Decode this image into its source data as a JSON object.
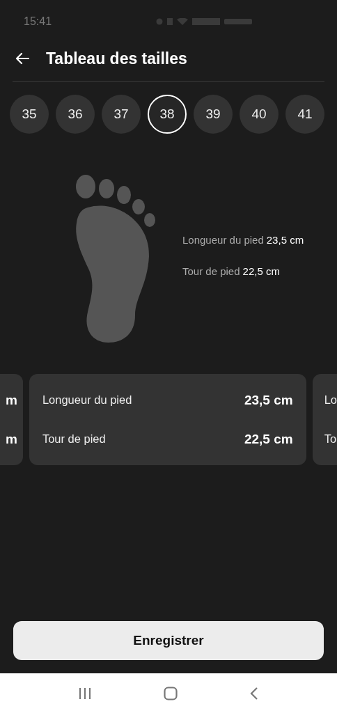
{
  "status_bar": {
    "time": "15:41"
  },
  "header": {
    "title": "Tableau des tailles"
  },
  "sizes": [
    {
      "label": "35",
      "selected": false
    },
    {
      "label": "36",
      "selected": false
    },
    {
      "label": "37",
      "selected": false
    },
    {
      "label": "38",
      "selected": true
    },
    {
      "label": "39",
      "selected": false
    },
    {
      "label": "40",
      "selected": false
    },
    {
      "label": "41",
      "selected": false
    }
  ],
  "foot_measures": [
    {
      "label": "Longueur du pied",
      "value": "23,5 cm"
    },
    {
      "label": "Tour de pied",
      "value": "22,5 cm"
    }
  ],
  "cards": [
    {
      "kind": "left-partial",
      "rows": [
        {
          "value": "m"
        },
        {
          "value": "m"
        }
      ]
    },
    {
      "kind": "full",
      "rows": [
        {
          "label": "Longueur du pied",
          "value": "23,5 cm"
        },
        {
          "label": "Tour de pied",
          "value": "22,5 cm"
        }
      ]
    },
    {
      "kind": "right-partial",
      "rows": [
        {
          "label": "Lo"
        },
        {
          "label": "To"
        }
      ]
    }
  ],
  "save_button": {
    "label": "Enregistrer"
  }
}
